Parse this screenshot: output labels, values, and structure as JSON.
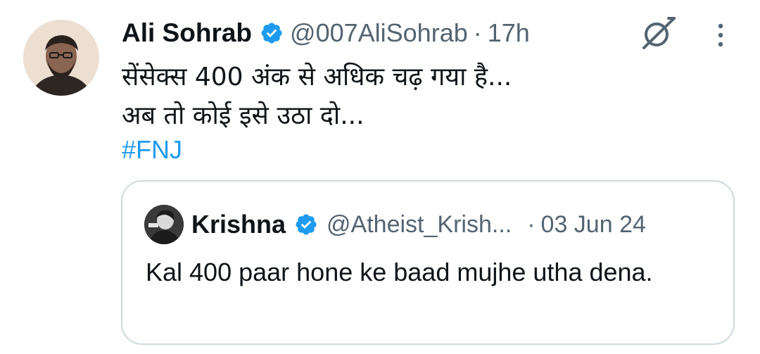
{
  "tweet": {
    "author_name": "Ali Sohrab",
    "handle": "@007AliSohrab",
    "separator": "·",
    "time": "17h",
    "text_lines": [
      "सेंसेक्स 400 अंक से अधिक चढ़ गया है...",
      "अब तो कोई इसे उठा दो..."
    ],
    "hashtag": "#FNJ"
  },
  "quoted_tweet": {
    "author_name": "Krishna",
    "handle": "@Atheist_Krish...",
    "separator": "·",
    "date": "03 Jun 24",
    "text": "Kal 400 paar hone ke baad mujhe utha dena."
  },
  "icons": {
    "verified": "verified-badge-icon",
    "grok": "grok-icon",
    "more": "more-options-icon"
  },
  "colors": {
    "accent": "#1d9bf0",
    "secondary_text": "#536471",
    "border": "#cfd9de"
  }
}
